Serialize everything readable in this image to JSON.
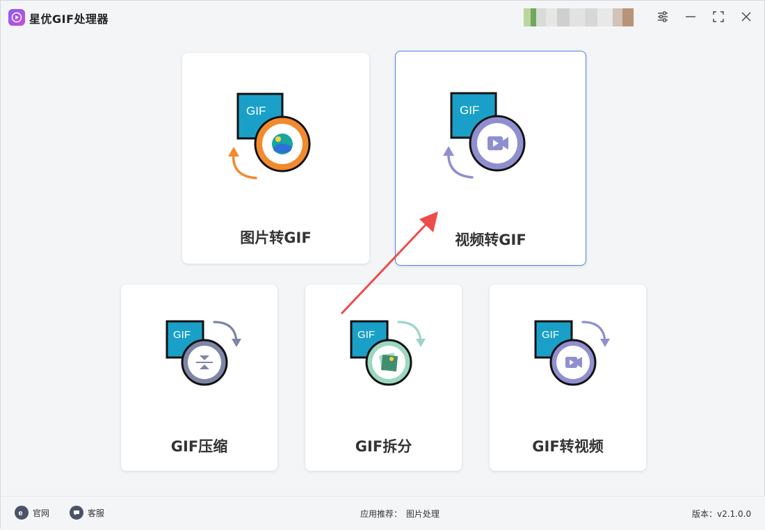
{
  "app": {
    "title": "星优GIF处理器"
  },
  "window_controls": {
    "settings_icon": "sliders-icon",
    "minimize_icon": "minimize-icon",
    "maximize_icon": "maximize-icon",
    "close_icon": "close-icon"
  },
  "cards": [
    {
      "label": "图片转GIF",
      "icon": "image-to-gif-icon",
      "accent": "#f28a2e"
    },
    {
      "label": "视频转GIF",
      "icon": "video-to-gif-icon",
      "accent": "#8f8fd0"
    },
    {
      "label": "GIF压缩",
      "icon": "gif-compress-icon",
      "accent": "#7d86a6"
    },
    {
      "label": "GIF拆分",
      "icon": "gif-split-icon",
      "accent": "#9ad8c0"
    },
    {
      "label": "GIF转视频",
      "icon": "gif-to-video-icon",
      "accent": "#8f8fd0"
    }
  ],
  "gif_badge": "GIF",
  "footer": {
    "website_label": "官网",
    "service_label": "客服",
    "recommend_prefix": "应用推荐：",
    "recommend_app": "图片处理",
    "version": "版本：v2.1.0.0"
  },
  "colors": {
    "gif_badge_bg": "#1aa0c8",
    "selected_border": "#4f86e6",
    "annotation_arrow": "#ee4b4b"
  }
}
